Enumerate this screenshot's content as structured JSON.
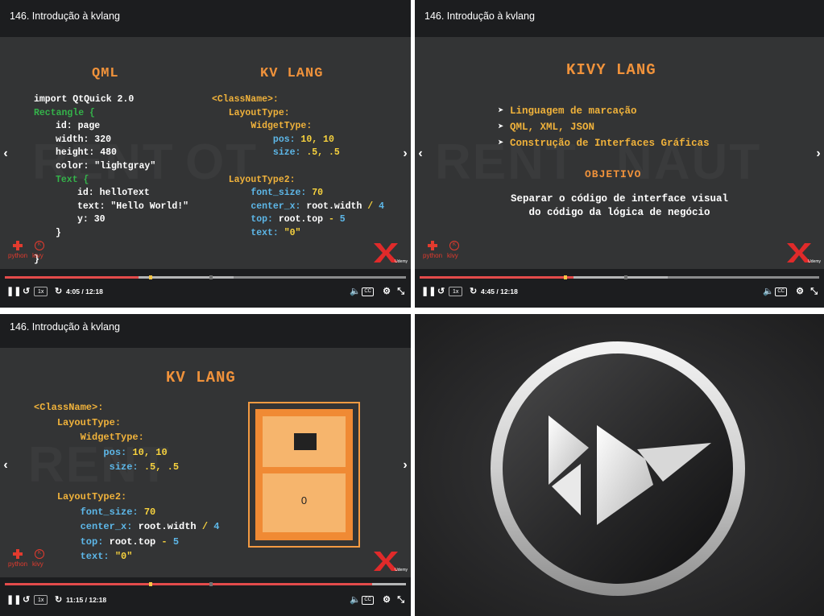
{
  "panels": [
    {
      "title": "146. Introdução à kvlang",
      "qml_heading": "QML",
      "kv_heading": "KV LANG",
      "qml_code": [
        {
          "text": "import QtQuick 2.0",
          "color": "w",
          "indent": 0
        },
        {
          "text": "Rectangle {",
          "color": "g",
          "indent": 0
        },
        {
          "text": "id: page",
          "color": "w",
          "indent": 1
        },
        {
          "text": "width: 320",
          "color": "w",
          "indent": 1
        },
        {
          "text": "height: 480",
          "color": "w",
          "indent": 1
        },
        {
          "text": "color: \"lightgray\"",
          "color": "w",
          "indent": 1
        },
        {
          "text": "Text {",
          "color": "g",
          "indent": 1
        },
        {
          "text": "id: helloText",
          "color": "w",
          "indent": 2
        },
        {
          "text": "text: \"Hello World!\"",
          "color": "w",
          "indent": 2
        },
        {
          "text": "y: 30",
          "color": "w",
          "indent": 2
        },
        {
          "text": "}",
          "color": "w",
          "indent": 1
        },
        {
          "text": "",
          "color": "w",
          "indent": 0
        },
        {
          "text": "}",
          "color": "w",
          "indent": 0
        }
      ],
      "time": "4:05 / 12:18",
      "rate": "1x",
      "progress_percent": 33.3
    },
    {
      "title": "146. Introdução à kvlang",
      "heading": "KIVY LANG",
      "bullets": [
        "Linguagem de marcação",
        "QML, XML, JSON",
        "Construção de Interfaces Gráficas"
      ],
      "objective_heading": "OBJETIVO",
      "objective_lines": [
        "Separar o código de interface visual",
        "do código da lógica de negócio"
      ],
      "time": "4:45 / 12:18",
      "rate": "1x",
      "progress_percent": 38.6
    },
    {
      "title": "146. Introdução à kvlang",
      "heading": "KV LANG",
      "diagram_label": "0",
      "time": "11:15 / 12:18",
      "rate": "1x",
      "progress_percent": 91.5
    }
  ],
  "kv_code": {
    "class_name": "<ClassName>:",
    "layout_type": "LayoutType:",
    "widget_type": "WidgetType:",
    "pos_key": "pos:",
    "pos_val": " 10, 10",
    "size_key": "size:",
    "size_val": " .5, .5",
    "layout_type2": "LayoutType2:",
    "font_key": "font_size:",
    "font_val": " 70",
    "cx_key": "center_x:",
    "cx_val": " root.width",
    "cx_op": " / ",
    "cx_num": "4",
    "top_key": "top:",
    "top_val": " root.top",
    "top_op": " - ",
    "top_num": "5",
    "text_key": "text:",
    "text_val": " \"0\""
  },
  "logos": {
    "python": "python",
    "kivy": "kivy",
    "udemy": "Udemy"
  },
  "icons": [
    "pause-icon",
    "replay-icon",
    "forward-icon",
    "volume-icon",
    "captions-icon",
    "settings-icon",
    "fullscreen-icon",
    "chevron-left-icon",
    "chevron-right-icon"
  ],
  "colors": {
    "accent_orange": "#f0923b",
    "green": "#34b34a",
    "blue": "#5db7e8",
    "yellow": "#f7d23e",
    "progress_red": "#e34b4b",
    "slide_bg": "#333435"
  }
}
